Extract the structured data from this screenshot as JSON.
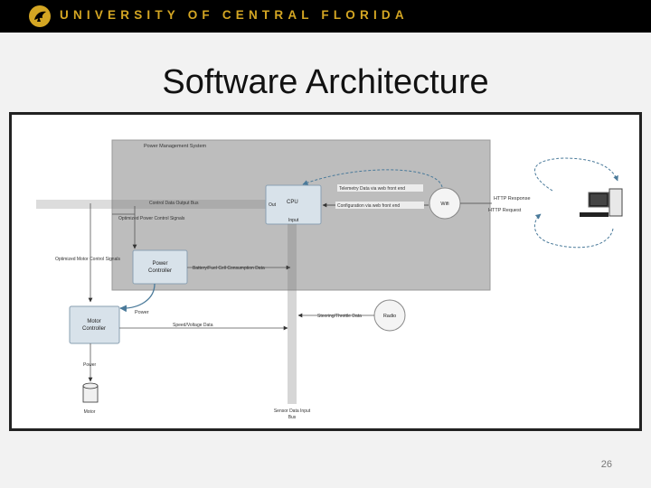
{
  "banner": {
    "text": "UNIVERSITY OF CENTRAL FLORIDA"
  },
  "slide": {
    "title": "Software Architecture",
    "page_number": "26"
  },
  "diagram": {
    "pms_label": "Power Management System",
    "cpu": {
      "label": "CPU",
      "out": "Out",
      "input": "Input"
    },
    "wifi": "Wifi",
    "radio": "Radio",
    "power_controller": [
      "Power",
      "Controller"
    ],
    "motor_controller": [
      "Motor",
      "Controller"
    ],
    "motor": "Motor",
    "labels": {
      "telemetry": "Telemetry Data via web front end",
      "configuration": "Configuration via web front end",
      "control_data_output": "Control Data Output Bus",
      "optimized_power": "Optimized Power Control Signals",
      "optimized_motor": "Optimized Motor Control Signals",
      "battery_fuel": "Battery/Fuel Cell Consumption Data",
      "power": "Power",
      "speed_voltage": "Speed/Voltage Data",
      "steering": "Steering/Throttle Data",
      "sensor_1": "Sensor Data Input",
      "sensor_2": "Bus",
      "http_response": "HTTP Response",
      "http_request": "HTTP Request",
      "power_motor": "Power"
    }
  }
}
